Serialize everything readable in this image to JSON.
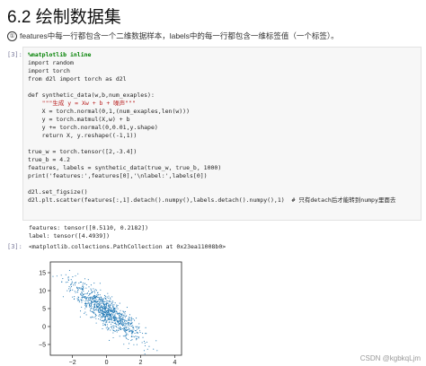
{
  "page": {
    "title": "6.2 绘制数据集",
    "note_marker": "①",
    "note_text": "features中每一行都包含一个二维数据样本，labels中的每一行都包含一维标签值（一个标签）。"
  },
  "cell_input": {
    "prompt": "[3]:",
    "lines": [
      "%matplotlib inline",
      "import random",
      "import torch",
      "from d2l import torch as d2l",
      "",
      "def synthetic_data(w,b,num_exaples):",
      "    \"\"\"生成 y = Xw + b + 噪声\"\"\"",
      "    X = torch.normal(0,1,(num_exaples,len(w)))",
      "    y = torch.matmul(X,w) + b",
      "    y += torch.normal(0,0.01,y.shape)",
      "    return X, y.reshape((-1,1))",
      "",
      "true_w = torch.tensor([2,-3.4])",
      "true_b = 4.2",
      "features, labels = synthetic_data(true_w, true_b, 1000)",
      "print('features:',features[0],'\\nlabel:',labels[0])",
      "",
      "d2l.set_figsize()",
      "d2l.plt.scatter(features[:,1].detach().numpy(),labels.detach().numpy(),1)  # 只有detach后才能转到numpy里面去"
    ]
  },
  "cell_output": {
    "stdout": [
      "features: tensor([0.5110, 0.2182])",
      "label: tensor([4.4939])"
    ],
    "prompt": "[3]:",
    "result": "<matplotlib.collections.PathCollection at 0x23ea11008b0>"
  },
  "chart_data": {
    "type": "scatter",
    "title": "",
    "xlabel": "",
    "ylabel": "",
    "xlim": [
      -3.3,
      4.4
    ],
    "ylim": [
      -8,
      18
    ],
    "xticks": [
      -2,
      0,
      2,
      4
    ],
    "yticks": [
      -5,
      0,
      5,
      10,
      15
    ],
    "series": [
      {
        "color": "#1f77b4",
        "true_w": [
          2,
          -3.4
        ],
        "true_b": 4.2,
        "n_points": 1000
      }
    ]
  },
  "watermark": "CSDN @kgbkqLjm"
}
